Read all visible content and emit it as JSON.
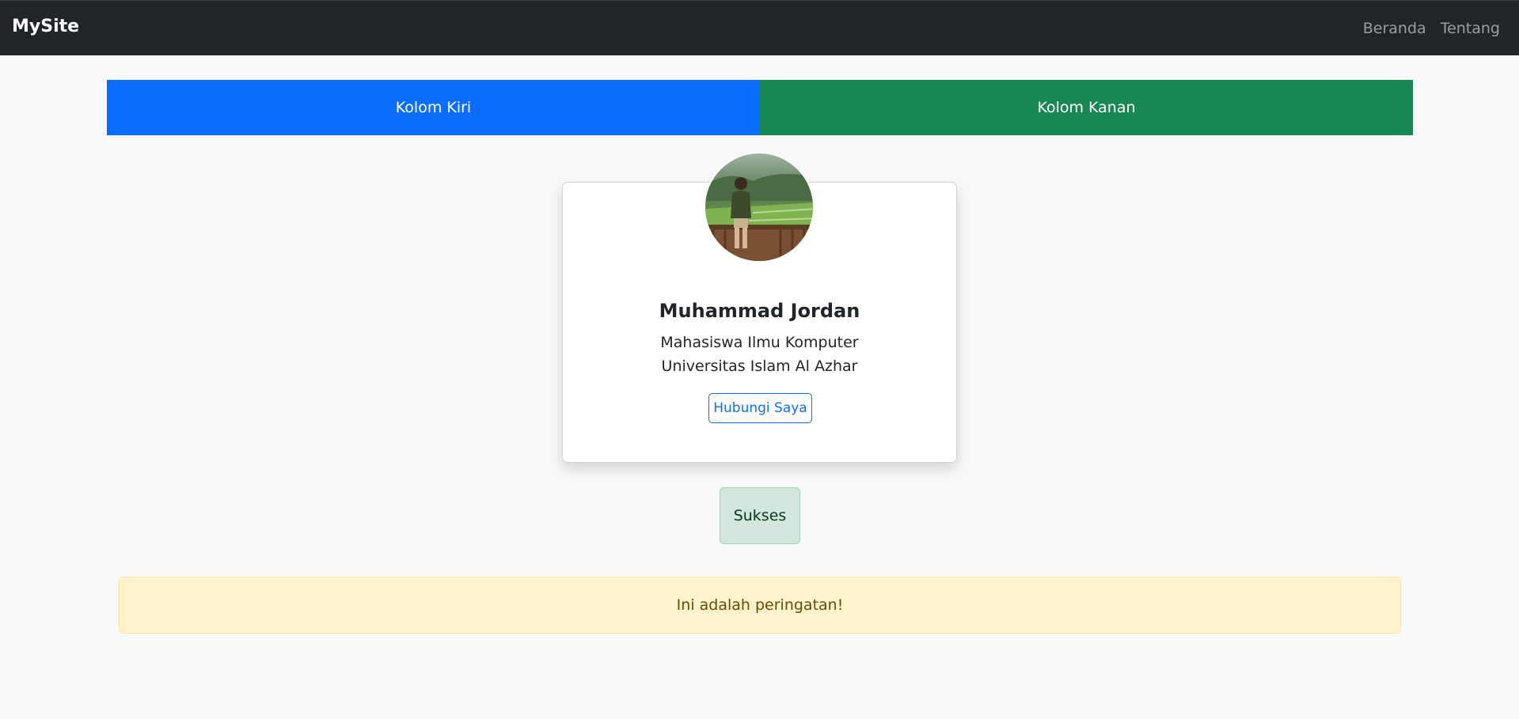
{
  "navbar": {
    "brand": "MySite",
    "links": [
      "Beranda",
      "Tentang"
    ]
  },
  "columns": {
    "left": "Kolom Kiri",
    "right": "Kolom Kanan"
  },
  "profile": {
    "name": "Muhammad Jordan",
    "line1": "Mahasiswa Ilmu Komputer",
    "line2": "Universitas Islam Al Azhar",
    "button": "Hubungi Saya"
  },
  "alerts": {
    "success": "Sukses",
    "warning": "Ini adalah peringatan!"
  },
  "colors": {
    "navbar_bg": "#212529",
    "primary": "#0d6efd",
    "success": "#198754",
    "page_bg": "#f8f9fa",
    "warning_bg": "#fff3cd",
    "success_bg": "#d1e7dd"
  }
}
